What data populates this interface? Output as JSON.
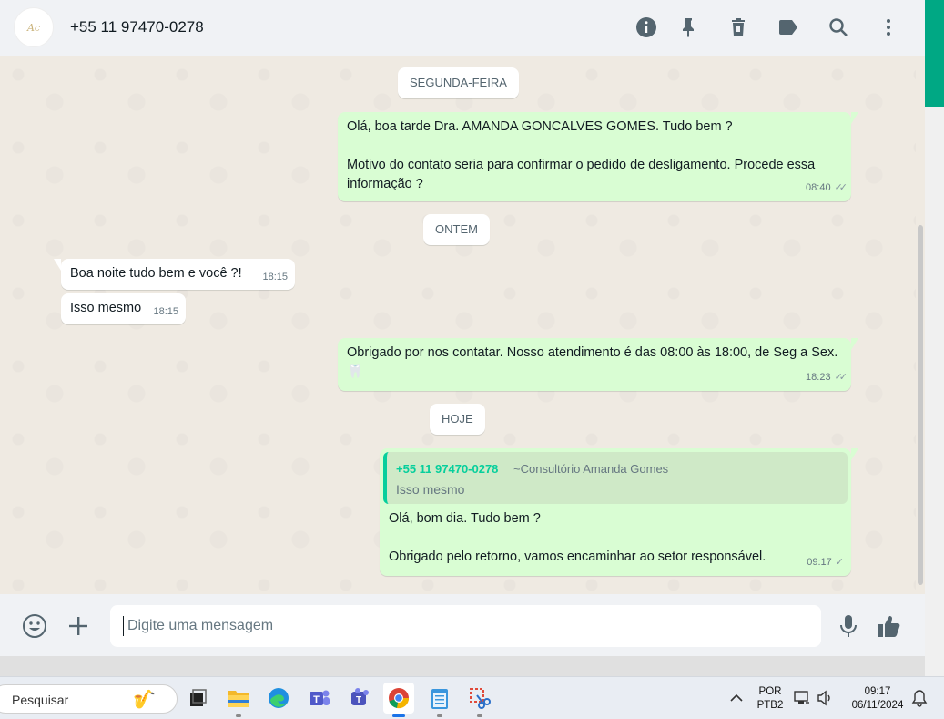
{
  "header": {
    "contact_name": "+55 11 97470-0278",
    "icons": [
      "info-icon",
      "pin-icon",
      "delete-icon",
      "label-icon",
      "search-icon",
      "menu-icon"
    ]
  },
  "chat": {
    "date_chips": [
      "SEGUNDA-FEIRA",
      "ONTEM",
      "HOJE"
    ],
    "messages": [
      {
        "direction": "out",
        "text": "Olá, boa tarde Dra. AMANDA GONCALVES GOMES. Tudo bem ?\n\nMotivo do contato seria para confirmar o pedido de desligamento. Procede essa informação ?",
        "time": "08:40",
        "status": "read"
      },
      {
        "direction": "in",
        "text": "Boa noite tudo bem e você ?!",
        "time": "18:15"
      },
      {
        "direction": "in",
        "text": "Isso mesmo",
        "time": "18:15"
      },
      {
        "direction": "out",
        "text": "Obrigado por nos contatar. Nosso atendimento é das 08:00 às 18:00, de Seg a Sex.🦷",
        "time": "18:23",
        "status": "read"
      },
      {
        "direction": "out",
        "quote": {
          "author": "+55 11 97470-0278",
          "alias": "~Consultório Amanda Gomes",
          "text": "Isso mesmo"
        },
        "text": "Olá, bom dia. Tudo bem ?\n\nObrigado pelo retorno, vamos encaminhar ao setor responsável.",
        "time": "09:17",
        "status": "sent"
      }
    ]
  },
  "composer": {
    "placeholder": "Digite uma mensagem",
    "icons": [
      "emoji-icon",
      "attach-plus-icon",
      "microphone-icon",
      "thumbs-up-icon"
    ]
  },
  "taskbar": {
    "search_label": "Pesquisar",
    "language_line1": "POR",
    "language_line2": "PTB2",
    "time": "09:17",
    "date": "06/11/2024"
  },
  "colors": {
    "outgoing_bubble": "#d9fdd3",
    "incoming_bubble": "#ffffff",
    "chat_background": "#efeae2",
    "accent": "#00a884",
    "quote_author": "#06cf9c"
  }
}
